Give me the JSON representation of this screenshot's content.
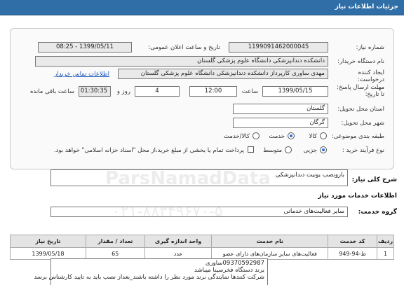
{
  "header": {
    "title": "جزئیات اطلاعات نیاز"
  },
  "fields": {
    "need_number_label": "شماره نیاز:",
    "need_number": "1199091462000045",
    "announce_label": "تاریخ و ساعت اعلان عمومی:",
    "announce_value": "1399/05/11 - 08:25",
    "buyer_org_label": "نام دستگاه خریدار:",
    "buyer_org": "دانشکده دندانپزشکی دانشگاه علوم پزشکی گلستان",
    "creator_label": "ایجاد کننده درخواست:",
    "creator": "مهدی ساوری کارپرداز دانشکده دندانپزشکی دانشگاه علوم پزشکی گلستان",
    "contact_link": "اطلاعات تماس خریدار",
    "deadline_label": "مهلت ارسال پاسخ: تا تاریخ:",
    "deadline_date": "1399/05/15",
    "time_label": "ساعت",
    "deadline_time": "12:00",
    "days_value": "4",
    "days_label": "روز و",
    "remaining_time": "01:30:35",
    "remaining_label": "ساعت باقی مانده",
    "province_label": "استان محل تحویل:",
    "province": "گلستان",
    "city_label": "شهر محل تحویل:",
    "city": "گرگان",
    "category_label": "طبقه بندی موضوعی:",
    "category_options": [
      "کالا",
      "خدمت",
      "کالا/خدمت"
    ],
    "process_label": "نوع فرآیند خرید :",
    "process_options": [
      "جزیی",
      "متوسط"
    ],
    "payment_note": "پرداخت تمام یا بخشی از مبلغ خرید،از محل \"اسناد خزانه اسلامی\" خواهد بود."
  },
  "summary": {
    "label": "شرح کلی نیاز:",
    "value": "بازونصب یونیت دندانپزشکی"
  },
  "services": {
    "section_title": "اطلاعات خدمات مورد نیاز",
    "group_label": "گروه خدمت:",
    "group_value": "سایر فعالیت‌های خدماتی"
  },
  "table": {
    "headers": [
      "ردیف",
      "کد خدمت",
      "نام خدمت",
      "واحد اندازه گیری",
      "تعداد / مقدار",
      "تاریخ نیاز"
    ],
    "rows": [
      [
        "1",
        "ط-94-949",
        "فعالیت‌های سایر سازمان‌های دارای عضو",
        "عدد",
        "65",
        "1399/05/18"
      ]
    ]
  },
  "description": {
    "line1": "09370592987ساوری",
    "line2": "برند دستگاه فخرسینا میباشد",
    "line3": "شرکت کنندها نمایندگی برند مورد نظر را داشته باشند_بعداز نصب باید به تایید کارشناس برسد"
  },
  "watermark": {
    "line1": "ParsNamadData",
    "line2": "۰۲۱-۸۸۳۴۹۶۷۰-۵"
  },
  "colors": {
    "header_bg": "#2f6ea6",
    "link": "#1b56b8",
    "radio_on": "#2a6fdb"
  }
}
